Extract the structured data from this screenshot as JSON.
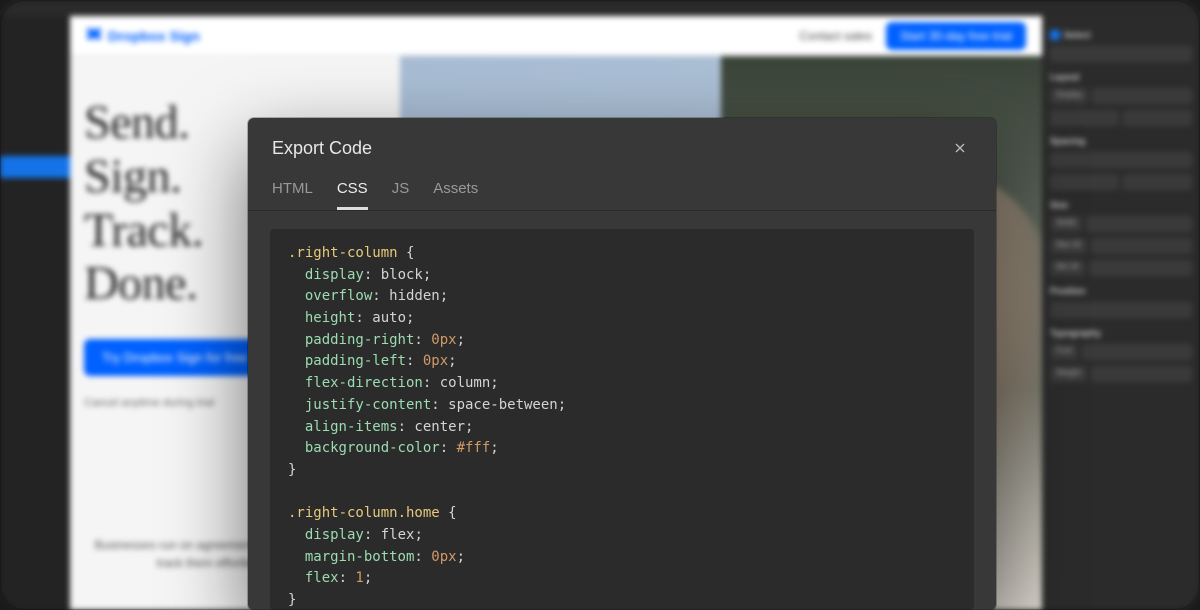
{
  "tool": {
    "left_rail_active": true,
    "right_panel": {
      "sections": [
        "Select",
        "Layout",
        "Spacing",
        "Size",
        "Position",
        "Typography"
      ],
      "layout_pills": [
        "Display"
      ],
      "size_rows": [
        "Width",
        "Max W",
        "Min W"
      ],
      "typography_rows": [
        "Font",
        "Weight"
      ]
    }
  },
  "website": {
    "logo_text": "Dropbox Sign",
    "contact_label": "Contact sales",
    "trial_label": "Start 30-day free trial",
    "headline_lines": [
      "Send.",
      "Sign.",
      "Track.",
      "Done."
    ],
    "cta_label": "Try Dropbox Sign for free",
    "subtext": "Cancel anytime during trial",
    "bottom_para": "Businesses run on agreements — send, sign, and track them effortlessly with"
  },
  "modal": {
    "title": "Export Code",
    "tabs": [
      "HTML",
      "CSS",
      "JS",
      "Assets"
    ],
    "active_tab": "CSS",
    "code": [
      [
        {
          "t": "selector",
          "v": ".right-column "
        },
        {
          "t": "brace",
          "v": "{"
        }
      ],
      [
        {
          "t": "indent"
        },
        {
          "t": "prop",
          "v": "display"
        },
        {
          "t": "colon",
          "v": ": "
        },
        {
          "t": "value",
          "v": "block"
        },
        {
          "t": "semi",
          "v": ";"
        }
      ],
      [
        {
          "t": "indent"
        },
        {
          "t": "prop",
          "v": "overflow"
        },
        {
          "t": "colon",
          "v": ": "
        },
        {
          "t": "value",
          "v": "hidden"
        },
        {
          "t": "semi",
          "v": ";"
        }
      ],
      [
        {
          "t": "indent"
        },
        {
          "t": "prop",
          "v": "height"
        },
        {
          "t": "colon",
          "v": ": "
        },
        {
          "t": "value",
          "v": "auto"
        },
        {
          "t": "semi",
          "v": ";"
        }
      ],
      [
        {
          "t": "indent"
        },
        {
          "t": "prop",
          "v": "padding-right"
        },
        {
          "t": "colon",
          "v": ": "
        },
        {
          "t": "number",
          "v": "0px"
        },
        {
          "t": "semi",
          "v": ";"
        }
      ],
      [
        {
          "t": "indent"
        },
        {
          "t": "prop",
          "v": "padding-left"
        },
        {
          "t": "colon",
          "v": ": "
        },
        {
          "t": "number",
          "v": "0px"
        },
        {
          "t": "semi",
          "v": ";"
        }
      ],
      [
        {
          "t": "indent"
        },
        {
          "t": "prop",
          "v": "flex-direction"
        },
        {
          "t": "colon",
          "v": ": "
        },
        {
          "t": "value",
          "v": "column"
        },
        {
          "t": "semi",
          "v": ";"
        }
      ],
      [
        {
          "t": "indent"
        },
        {
          "t": "prop",
          "v": "justify-content"
        },
        {
          "t": "colon",
          "v": ": "
        },
        {
          "t": "value",
          "v": "space-between"
        },
        {
          "t": "semi",
          "v": ";"
        }
      ],
      [
        {
          "t": "indent"
        },
        {
          "t": "prop",
          "v": "align-items"
        },
        {
          "t": "colon",
          "v": ": "
        },
        {
          "t": "value",
          "v": "center"
        },
        {
          "t": "semi",
          "v": ";"
        }
      ],
      [
        {
          "t": "indent"
        },
        {
          "t": "prop",
          "v": "background-color"
        },
        {
          "t": "colon",
          "v": ": "
        },
        {
          "t": "hex",
          "v": "#fff"
        },
        {
          "t": "semi",
          "v": ";"
        }
      ],
      [
        {
          "t": "brace",
          "v": "}"
        }
      ],
      [],
      [
        {
          "t": "selector",
          "v": ".right-column.home "
        },
        {
          "t": "brace",
          "v": "{"
        }
      ],
      [
        {
          "t": "indent"
        },
        {
          "t": "prop",
          "v": "display"
        },
        {
          "t": "colon",
          "v": ": "
        },
        {
          "t": "value",
          "v": "flex"
        },
        {
          "t": "semi",
          "v": ";"
        }
      ],
      [
        {
          "t": "indent"
        },
        {
          "t": "prop",
          "v": "margin-bottom"
        },
        {
          "t": "colon",
          "v": ": "
        },
        {
          "t": "number",
          "v": "0px"
        },
        {
          "t": "semi",
          "v": ";"
        }
      ],
      [
        {
          "t": "indent"
        },
        {
          "t": "prop",
          "v": "flex"
        },
        {
          "t": "colon",
          "v": ": "
        },
        {
          "t": "number",
          "v": "1"
        },
        {
          "t": "semi",
          "v": ";"
        }
      ],
      [
        {
          "t": "brace",
          "v": "}"
        }
      ]
    ]
  }
}
